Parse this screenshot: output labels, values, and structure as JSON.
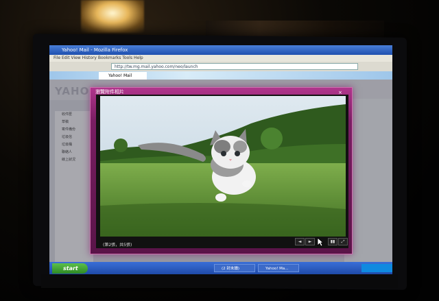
{
  "browser": {
    "window_title": "Yahoo! Mail - Mozilla Firefox",
    "url": "http://tw.mg.mail.yahoo.com/neo/launch",
    "tab_label": "Yahoo! Mail",
    "menu": "File  Edit  View  History  Bookmarks  Tools  Help"
  },
  "yahoo": {
    "logo": "YAHOO!",
    "sidebar_items": [
      "收件匣",
      "草稿",
      "寄件備份",
      "垃圾信",
      "垃圾桶",
      "聯絡人",
      "線上狀況"
    ]
  },
  "lightbox": {
    "title": "瀏覽附件相片",
    "close": "×",
    "caption": "(第2張，共5張)",
    "controls": [
      "◄",
      "►",
      "▮▮",
      "⤢"
    ]
  },
  "taskbar": {
    "start_label": "start",
    "items": [
      "(2 封未讀)",
      "Yahoo! Ma..."
    ]
  },
  "colors": {
    "lightbox_accent": "#8b2575",
    "taskbar": "#2a5bc6",
    "grass": "#5f9a3a",
    "sky": "#c7dcea"
  }
}
